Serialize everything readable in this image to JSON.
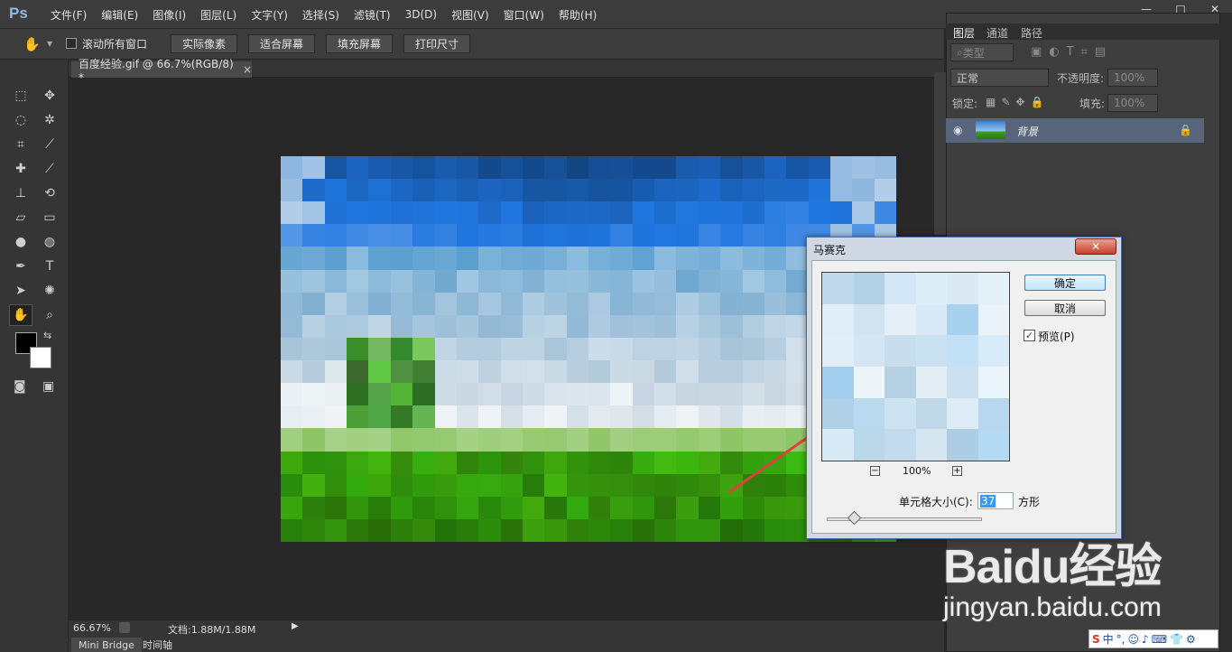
{
  "app": {
    "logo": "Ps"
  },
  "menu": [
    "文件(F)",
    "编辑(E)",
    "图像(I)",
    "图层(L)",
    "文字(Y)",
    "选择(S)",
    "滤镜(T)",
    "3D(D)",
    "视图(V)",
    "窗口(W)",
    "帮助(H)"
  ],
  "window_controls": {
    "minimize": "—",
    "maximize": "□",
    "close": "✕"
  },
  "options_bar": {
    "scroll_all_label": "滚动所有窗口",
    "buttons": [
      "实际像素",
      "适合屏幕",
      "填充屏幕",
      "打印尺寸"
    ]
  },
  "document": {
    "tab_title": "百度经验.gif @ 66.7%(RGB/8) *",
    "tab_close": "×"
  },
  "status_bar": {
    "zoom": "66.67%",
    "doc_info": "文档:1.88M/1.88M"
  },
  "bottom_tabs": [
    "Mini Bridge",
    "时间轴"
  ],
  "layers_panel": {
    "tabs": [
      "图层",
      "通道",
      "路径"
    ],
    "filter_label": "类型",
    "blend_mode": "正常",
    "opacity_label": "不透明度:",
    "opacity_value": "100%",
    "lock_label": "锁定:",
    "fill_label": "填充:",
    "fill_value": "100%",
    "layer_name": "背景"
  },
  "mosaic_dialog": {
    "title": "马赛克",
    "close": "✕",
    "ok_label": "确定",
    "cancel_label": "取消",
    "preview_label": "预览(P)",
    "preview_checked": true,
    "zoom_level": "100%",
    "zoom_out": "−",
    "zoom_in": "+",
    "cell_size_label": "单元格大小(C):",
    "cell_size_value": "37",
    "unit_label": "方形"
  },
  "watermark": {
    "line1": "Baidu经验",
    "line2": "jingyan.baidu.com"
  },
  "ime": {
    "label": "中"
  },
  "colors": {
    "accent_blue": "#3399ff",
    "arrow_red": "#e04040",
    "layer_selected": "#57657a"
  }
}
